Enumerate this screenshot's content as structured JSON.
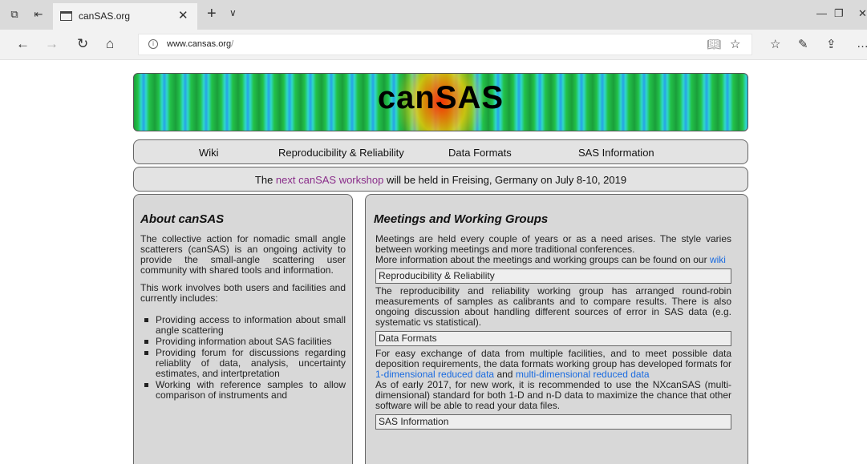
{
  "browser": {
    "tab_title": "canSAS.org",
    "url_host": "www.cansas.org",
    "url_slash": "/"
  },
  "site": {
    "banner_title": "canSAS",
    "menu": [
      "Wiki",
      "Reproducibility & Reliability",
      "Data Formats",
      "SAS Information"
    ],
    "notice": {
      "prefix": "The ",
      "link": "next canSAS workshop",
      "suffix": " will be held in Freising, Germany on July 8-10, 2019"
    }
  },
  "about": {
    "heading": "About canSAS",
    "para1": "The collective action for nomadic small angle scatterers (canSAS) is an ongoing activity to provide the small-angle scattering user community with shared tools and information.",
    "para2": "This work involves both users and facilities and currently includes:",
    "items": [
      "Providing access to information about small angle scattering",
      "Providing information about SAS facilities",
      "Providing forum for discussions regarding reliablity of data, analysis, uncertainty estimates, and intertpretation",
      "Working with reference samples to allow comparison of instruments and"
    ]
  },
  "meetings": {
    "heading": "Meetings and Working Groups",
    "intro1": "Meetings are held every couple of years or as a need arises. The style varies between working meetings and more traditional conferences.",
    "intro2_prefix": "More information about the meetings and working groups can be found on our ",
    "intro2_link": "wiki",
    "rr_title": "Reproducibility & Reliability",
    "rr_text": "The reproducibility and reliability working group has arranged round-robin measurements of samples as calibrants and to compare results. There is also ongoing discussion about handling different sources of error in SAS data (e.g. systematic vs statistical).",
    "df_title": "Data Formats",
    "df_text1": "For easy exchange of data from multiple facilities, and to meet possible data deposition requirements, the data formats working group has developed formats for ",
    "df_link1": "1-dimensional reduced data",
    "df_and": " and ",
    "df_link2": "multi-dimensional reduced data",
    "df_text2": "As of early 2017, for new work, it is recommended to use the NXcanSAS (multi-dimensional) standard for both 1-D and n-D data to maximize the chance that other software will be able to read your data files.",
    "sas_title": "SAS Information"
  }
}
